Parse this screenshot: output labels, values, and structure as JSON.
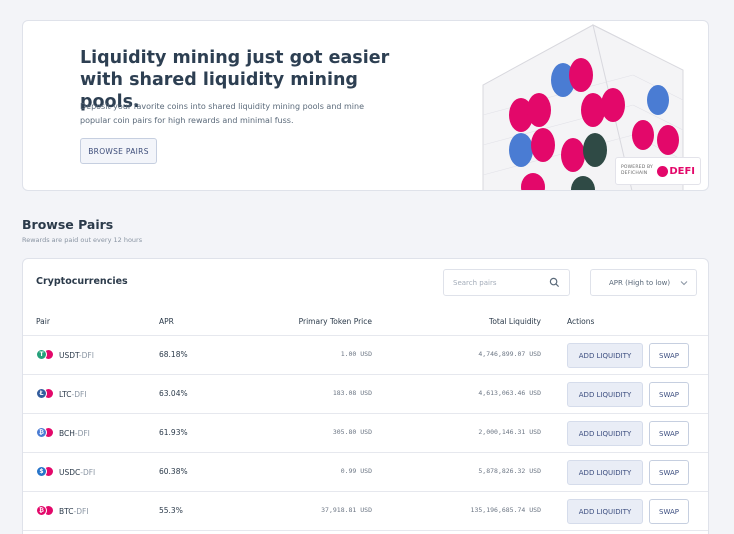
{
  "hero": {
    "title": "Liquidity mining just got easier with shared liquidity mining pools.",
    "description": "Deposit your favorite coins into shared liquidity mining pools and mine popular coin pairs for high rewards and minimal fuss.",
    "button": "BROWSE PAIRS",
    "powered_by": "POWERED BY DEFICHAIN",
    "logo_text": "DEFI"
  },
  "section": {
    "title": "Browse Pairs",
    "subtitle": "Rewards are paid out every 12 hours"
  },
  "panel": {
    "title": "Cryptocurrencies",
    "search_placeholder": "Search pairs",
    "sort_label": "APR (High to low)",
    "columns": {
      "pair": "Pair",
      "apr": "APR",
      "price": "Primary Token Price",
      "liquidity": "Total Liquidity",
      "actions": "Actions"
    },
    "rows": [
      {
        "token": "USDT",
        "suffix": "-DFI",
        "apr": "68.18%",
        "price": "1.00 USD",
        "liquidity": "4,746,899.07 USD",
        "color": "#26a17b",
        "glyph": "T"
      },
      {
        "token": "LTC",
        "suffix": "-DFI",
        "apr": "63.04%",
        "price": "183.08 USD",
        "liquidity": "4,613,063.46 USD",
        "color": "#345d9d",
        "glyph": "Ł"
      },
      {
        "token": "BCH",
        "suffix": "-DFI",
        "apr": "61.93%",
        "price": "305.80 USD",
        "liquidity": "2,000,146.31 USD",
        "color": "#4a7cd3",
        "glyph": "₿"
      },
      {
        "token": "USDC",
        "suffix": "-DFI",
        "apr": "60.38%",
        "price": "0.99 USD",
        "liquidity": "5,878,826.32 USD",
        "color": "#2775ca",
        "glyph": "$"
      },
      {
        "token": "BTC",
        "suffix": "-DFI",
        "apr": "55.3%",
        "price": "37,918.81 USD",
        "liquidity": "135,196,685.74 USD",
        "color": "#e3086a",
        "glyph": "₿"
      }
    ],
    "add_label": "ADD LIQUIDITY",
    "swap_label": "SWAP"
  },
  "colors": {
    "accent_pink": "#e3086a",
    "accent_blue": "#4a7cd3",
    "accent_dark": "#2f4a45"
  }
}
